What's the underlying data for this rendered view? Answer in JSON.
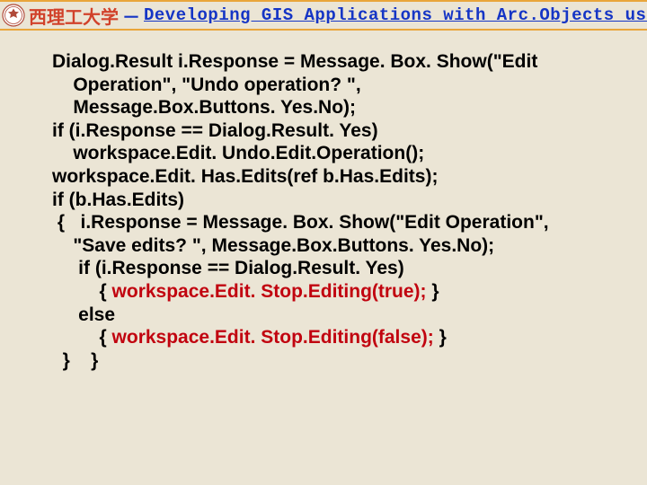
{
  "header": {
    "university": "西理工大学",
    "dash": "－",
    "course": "Developing GIS Applications with Arc.Objects using C#. NE"
  },
  "code": {
    "lines": [
      {
        "indent": 0,
        "plain": "Dialog.Result i.Response = Message. Box. Show(\"Edit"
      },
      {
        "indent": 1,
        "plain": "Operation\", \"Undo operation? \","
      },
      {
        "indent": 1,
        "plain": "Message.Box.Buttons. Yes.No);"
      },
      {
        "indent": 0,
        "plain": "if (i.Response == Dialog.Result. Yes)"
      },
      {
        "indent": 1,
        "plain": "workspace.Edit. Undo.Edit.Operation();"
      },
      {
        "indent": 0,
        "plain": "workspace.Edit. Has.Edits(ref b.Has.Edits);"
      },
      {
        "indent": 0,
        "plain": "if (b.Has.Edits)"
      },
      {
        "indent": 0,
        "plain": " {   i.Response = Message. Box. Show(\"Edit Operation\","
      },
      {
        "indent": 1,
        "plain": "\"Save edits? \", Message.Box.Buttons. Yes.No);"
      },
      {
        "indent": 1,
        "plain": " if (i.Response == Dialog.Result. Yes)"
      },
      {
        "indent": 2,
        "plain": " { ",
        "hl": "workspace.Edit. Stop.Editing(true);",
        "tail": " }"
      },
      {
        "indent": 1,
        "plain": " else"
      },
      {
        "indent": 2,
        "plain": " { ",
        "hl": "workspace.Edit. Stop.Editing(false);",
        "tail": " }"
      },
      {
        "indent": 0,
        "plain": "  }    }"
      }
    ]
  }
}
